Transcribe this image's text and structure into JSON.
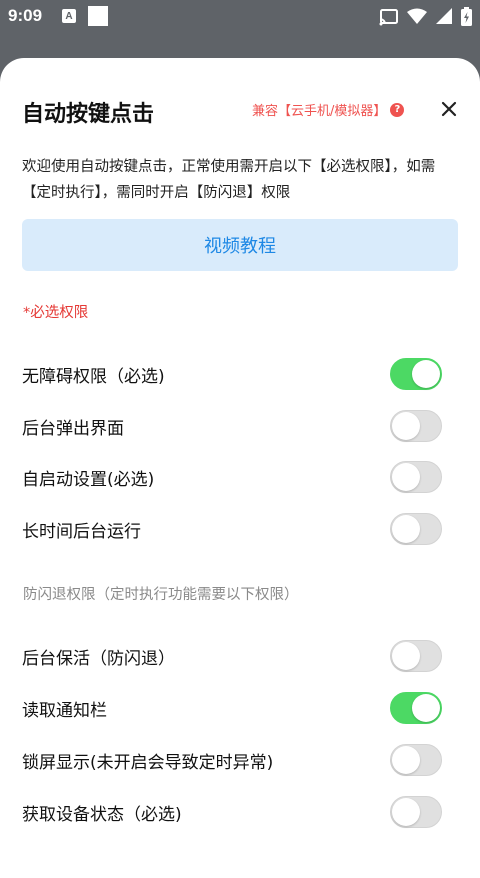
{
  "status_bar": {
    "time": "9:09",
    "a_icon_text": "A"
  },
  "header": {
    "title": "自动按键点击",
    "compat": "兼容【云手机/模拟器】",
    "help_glyph": "?"
  },
  "intro": "欢迎使用自动按键点击，正常使用需开启以下【必选权限】，如需【定时执行】，需同时开启【防闪退】权限",
  "video_button": "视频教程",
  "required_section": {
    "label": "*必选权限",
    "items": [
      {
        "label": "无障碍权限（必选)",
        "enabled": true
      },
      {
        "label": "后台弹出界面",
        "enabled": false
      },
      {
        "label": "自启动设置(必选)",
        "enabled": false
      },
      {
        "label": "长时间后台运行",
        "enabled": false
      }
    ]
  },
  "anti_crash_section": {
    "label": "防闪退权限（定时执行功能需要以下权限）",
    "items": [
      {
        "label": "后台保活（防闪退）",
        "enabled": false
      },
      {
        "label": "读取通知栏",
        "enabled": true
      },
      {
        "label": "锁屏显示(未开启会导致定时异常)",
        "enabled": false
      },
      {
        "label": "获取设备状态（必选)",
        "enabled": false
      }
    ]
  },
  "colors": {
    "accent": "#1e88e5",
    "warning": "#e53935",
    "toggle_on": "#4cd964",
    "toggle_off": "#e0e0e0"
  }
}
